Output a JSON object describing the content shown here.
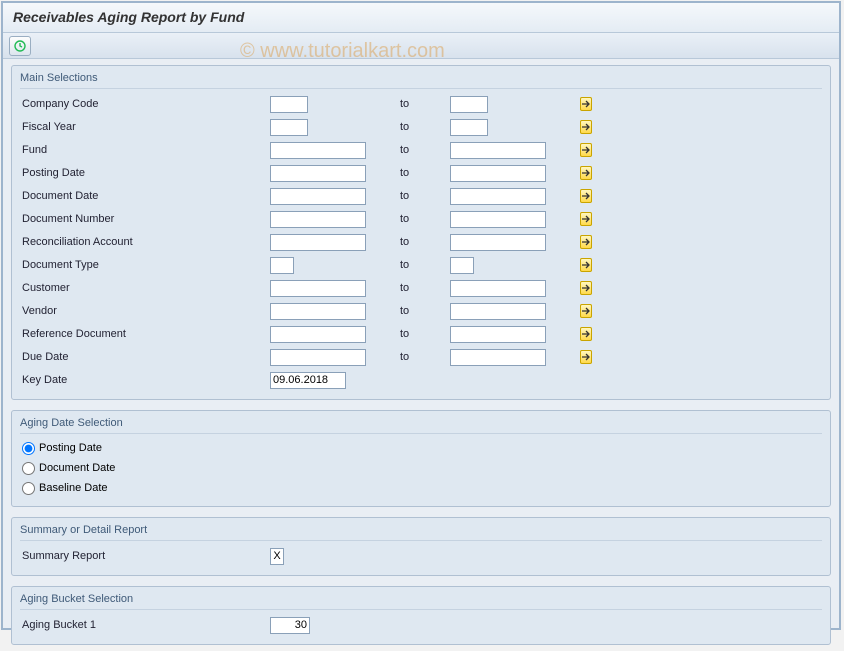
{
  "title": "Receivables Aging Report by Fund",
  "watermark": "© www.tutorialkart.com",
  "groups": {
    "main": {
      "title": "Main Selections",
      "fields": {
        "company_code": "Company Code",
        "fiscal_year": "Fiscal Year",
        "fund": "Fund",
        "posting_date": "Posting Date",
        "document_date": "Document Date",
        "document_number": "Document Number",
        "reconciliation_account": "Reconciliation Account",
        "document_type": "Document Type",
        "customer": "Customer",
        "vendor": "Vendor",
        "reference_document": "Reference Document",
        "due_date": "Due Date",
        "key_date": "Key Date",
        "to": "to"
      },
      "values": {
        "key_date": "09.06.2018"
      }
    },
    "aging_date": {
      "title": "Aging Date Selection",
      "options": {
        "posting": "Posting Date",
        "document": "Document Date",
        "baseline": "Baseline Date"
      },
      "selected": "posting"
    },
    "summary_detail": {
      "title": "Summary or Detail Report",
      "field": "Summary Report",
      "value": "X"
    },
    "bucket": {
      "title": "Aging Bucket Selection",
      "field": "Aging Bucket 1",
      "value": "30"
    }
  }
}
